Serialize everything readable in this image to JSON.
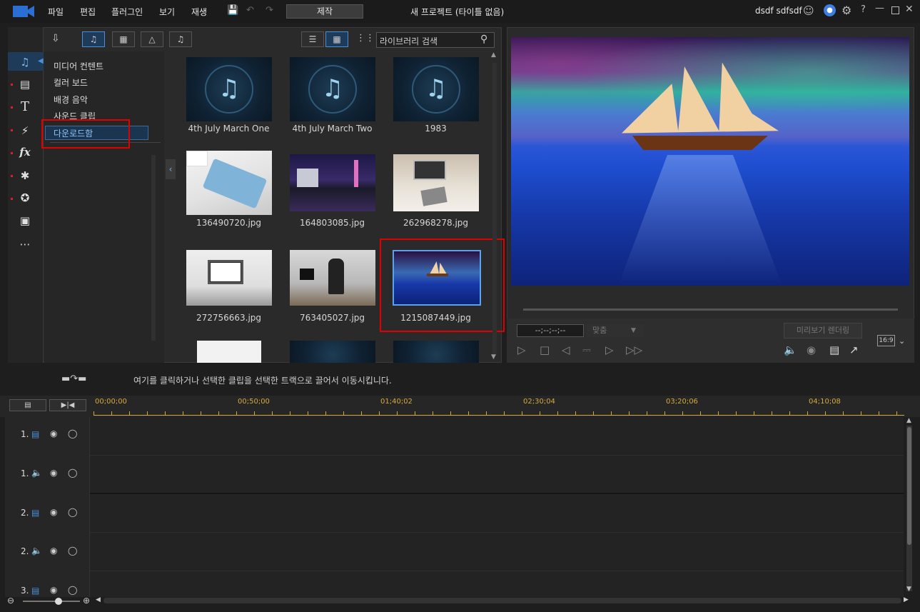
{
  "titlebar": {
    "menus": [
      "파일",
      "편집",
      "플러그인",
      "보기",
      "재생"
    ],
    "produce": "제작",
    "project_title": "새 프로젝트 (타이틀 없음)",
    "user": "dsdf sdfsdf",
    "help": "?"
  },
  "library": {
    "search_placeholder": "라이브러리 검색",
    "categories": [
      "미디어 컨텐트",
      "컬러 보드",
      "배경 음악",
      "사운드 클립",
      "다운로드함"
    ],
    "items": [
      {
        "label": "4th July March One",
        "kind": "music"
      },
      {
        "label": "4th July March Two",
        "kind": "music"
      },
      {
        "label": "1983",
        "kind": "music"
      },
      {
        "label": "136490720.jpg",
        "kind": "image"
      },
      {
        "label": "164803085.jpg",
        "kind": "image"
      },
      {
        "label": "262968278.jpg",
        "kind": "image"
      },
      {
        "label": "272756663.jpg",
        "kind": "image"
      },
      {
        "label": "763405027.jpg",
        "kind": "image"
      },
      {
        "label": "1215087449.jpg",
        "kind": "image"
      }
    ]
  },
  "preview": {
    "timecode": "--;--;--;--",
    "fit": "맞춤",
    "render": "미리보기 렌더링",
    "aspect": "16:9"
  },
  "hint": "여기를 클릭하거나 선택한 클립을 선택한 트랙으로 끌어서 이동시킵니다.",
  "timeline": {
    "times": [
      "00;00;00",
      "00;50;00",
      "01;40;02",
      "02;30;04",
      "03;20;06",
      "04;10;08"
    ],
    "tracks": [
      "1.",
      "1.",
      "2.",
      "2.",
      "3."
    ]
  },
  "colors": {
    "accent": "#4a90d9",
    "highlight": "#e00000",
    "ruler": "#d6a93e"
  }
}
